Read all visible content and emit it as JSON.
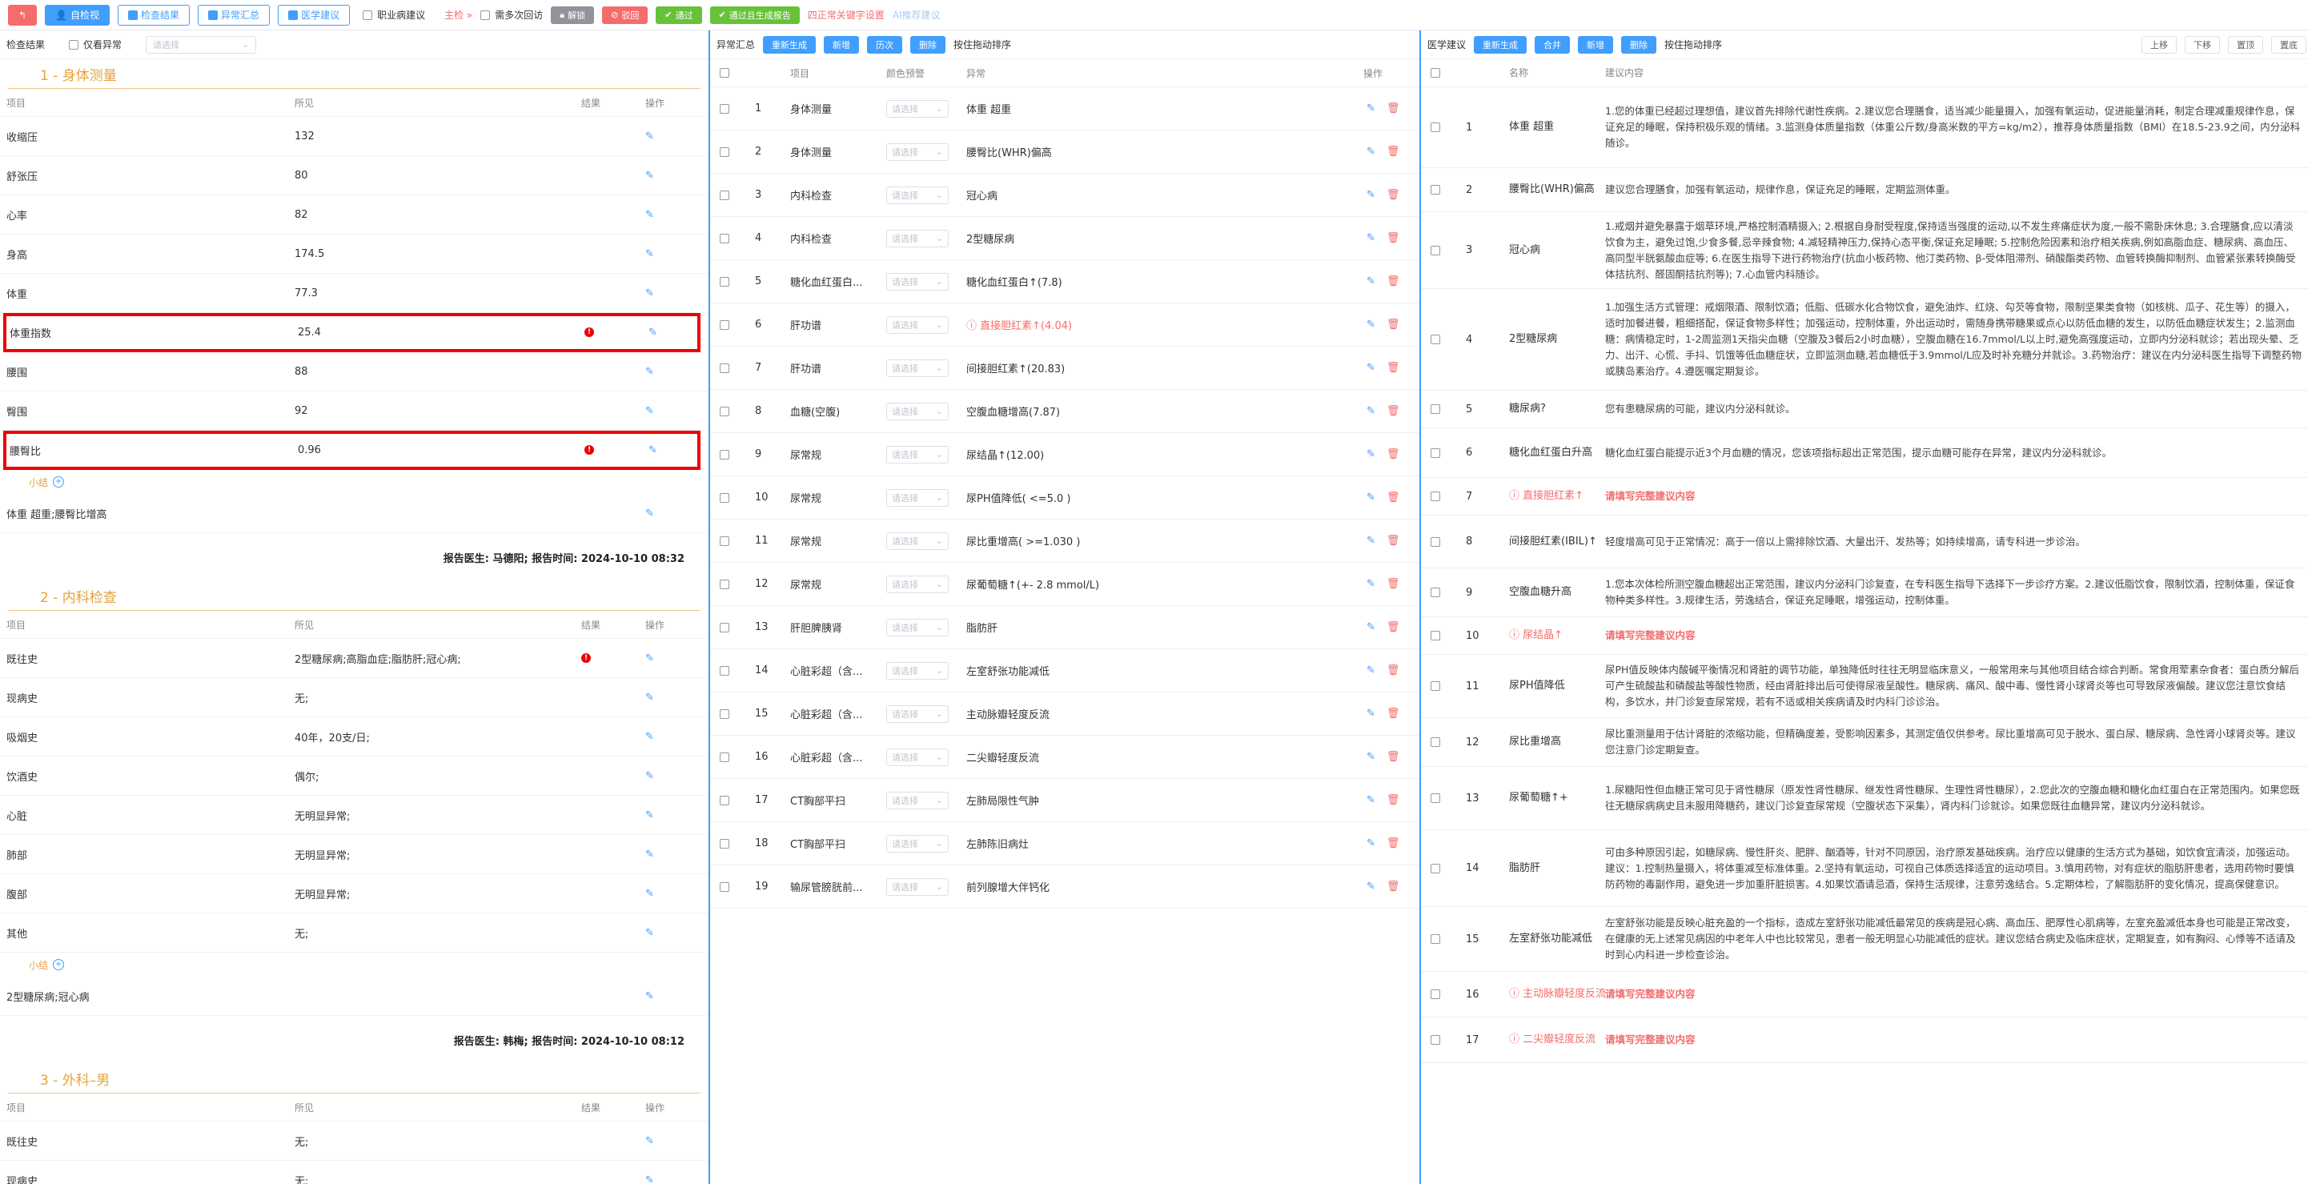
{
  "toolbar": {
    "back_label": "↰",
    "self_check_label": "自检视",
    "results_label": "检查结果",
    "abnormal_label": "异常汇总",
    "advice_label": "医学建议",
    "occupational_label": "职业病建议",
    "main_check_label": "主检 »",
    "multi_review_label": "需多次回访",
    "unlock_label": "解锁",
    "reject_label": "驳回",
    "pass_label": "通过",
    "pass_report_label": "通过且生成报告",
    "normal_shortcut_label": "四正常关键字设置",
    "ai_advice_label": "AI推荐建议"
  },
  "left": {
    "title": "检查结果",
    "only_abnormal_label": "仅看异常",
    "select_placeholder": "请选择",
    "col_item": "项目",
    "col_value": "所见",
    "col_result": "结果",
    "col_op": "操作",
    "subtotal_label": "小结",
    "sections": [
      {
        "title": "1 - 身体测量",
        "rows": [
          {
            "item": "收缩压",
            "value": "132",
            "warn": false,
            "hl": false
          },
          {
            "item": "舒张压",
            "value": "80",
            "warn": false,
            "hl": false
          },
          {
            "item": "心率",
            "value": "82",
            "warn": false,
            "hl": false
          },
          {
            "item": "身高",
            "value": "174.5",
            "warn": false,
            "hl": false
          },
          {
            "item": "体重",
            "value": "77.3",
            "warn": false,
            "hl": false
          },
          {
            "item": "体重指数",
            "value": "25.4",
            "warn": true,
            "hl": true
          },
          {
            "item": "腰围",
            "value": "88",
            "warn": false,
            "hl": false
          },
          {
            "item": "臀围",
            "value": "92",
            "warn": false,
            "hl": false
          },
          {
            "item": "腰臀比",
            "value": "0.96",
            "warn": true,
            "hl": true
          }
        ],
        "summary": "体重 超重;腰臀比增高",
        "doctor": "报告医生: 马德阳; 报告时间: 2024-10-10 08:32"
      },
      {
        "title": "2 - 内科检查",
        "rows": [
          {
            "item": "既往史",
            "value": "2型糖尿病;高脂血症;脂肪肝;冠心病;",
            "warn": true,
            "hl": false
          },
          {
            "item": "现病史",
            "value": "无;",
            "warn": false,
            "hl": false
          },
          {
            "item": "吸烟史",
            "value": "40年，20支/日;",
            "warn": false,
            "hl": false
          },
          {
            "item": "饮酒史",
            "value": "偶尔;",
            "warn": false,
            "hl": false
          },
          {
            "item": "心脏",
            "value": "无明显异常;",
            "warn": false,
            "hl": false
          },
          {
            "item": "肺部",
            "value": "无明显异常;",
            "warn": false,
            "hl": false
          },
          {
            "item": "腹部",
            "value": "无明显异常;",
            "warn": false,
            "hl": false
          },
          {
            "item": "其他",
            "value": "无;",
            "warn": false,
            "hl": false
          }
        ],
        "summary": "2型糖尿病;冠心病",
        "doctor": "报告医生: 韩梅; 报告时间: 2024-10-10 08:12"
      },
      {
        "title": "3 - 外科–男",
        "rows": [
          {
            "item": "既往史",
            "value": "无;",
            "warn": false,
            "hl": false
          },
          {
            "item": "现病史",
            "value": "无;",
            "warn": false,
            "hl": false
          }
        ],
        "summary": "",
        "doctor": ""
      }
    ]
  },
  "mid": {
    "title": "异常汇总",
    "regen_label": "重新生成",
    "add_label": "新增",
    "history_label": "历次",
    "delete_label": "删除",
    "sort_label": "按住拖动排序",
    "col_item": "项目",
    "col_color": "颜色预警",
    "col_abn": "异常",
    "col_op": "操作",
    "select_placeholder": "请选择",
    "rows": [
      {
        "no": "1",
        "item": "身体测量",
        "abn": "体重 超重",
        "red": false
      },
      {
        "no": "2",
        "item": "身体测量",
        "abn": "腰臀比(WHR)偏高",
        "red": false
      },
      {
        "no": "3",
        "item": "内科检查",
        "abn": "冠心病",
        "red": false
      },
      {
        "no": "4",
        "item": "内科检查",
        "abn": "2型糖尿病",
        "red": false
      },
      {
        "no": "5",
        "item": "糖化血红蛋白...",
        "abn": "糖化血红蛋白↑(7.8)",
        "red": false
      },
      {
        "no": "6",
        "item": "肝功谱",
        "abn": "ⓘ 直接胆红素↑(4.04)",
        "red": true
      },
      {
        "no": "7",
        "item": "肝功谱",
        "abn": "间接胆红素↑(20.83)",
        "red": false
      },
      {
        "no": "8",
        "item": "血糖(空腹)",
        "abn": "空腹血糖增高(7.87)",
        "red": false
      },
      {
        "no": "9",
        "item": "尿常规",
        "abn": "尿结晶↑(12.00)",
        "red": false
      },
      {
        "no": "10",
        "item": "尿常规",
        "abn": "尿PH值降低( <=5.0 )",
        "red": false
      },
      {
        "no": "11",
        "item": "尿常规",
        "abn": "尿比重增高( >=1.030 )",
        "red": false
      },
      {
        "no": "12",
        "item": "尿常规",
        "abn": "尿葡萄糖↑(+- 2.8 mmol/L)",
        "red": false
      },
      {
        "no": "13",
        "item": "肝胆脾胰肾",
        "abn": "脂肪肝",
        "red": false
      },
      {
        "no": "14",
        "item": "心脏彩超（含...",
        "abn": "左室舒张功能减低",
        "red": false
      },
      {
        "no": "15",
        "item": "心脏彩超（含...",
        "abn": "主动脉瓣轻度反流",
        "red": false
      },
      {
        "no": "16",
        "item": "心脏彩超（含...",
        "abn": "二尖瓣轻度反流",
        "red": false
      },
      {
        "no": "17",
        "item": "CT胸部平扫",
        "abn": "左肺局限性气肿",
        "red": false
      },
      {
        "no": "18",
        "item": "CT胸部平扫",
        "abn": "左肺陈旧病灶",
        "red": false
      },
      {
        "no": "19",
        "item": "输尿管膀胱前...",
        "abn": "前列腺增大伴钙化",
        "red": false
      }
    ]
  },
  "right": {
    "title": "医学建议",
    "regen_label": "重新生成",
    "merge_label": "合并",
    "add_label": "新增",
    "delete_label": "删除",
    "sort_label": "按住拖动排序",
    "up_label": "上移",
    "down_label": "下移",
    "top_label": "置顶",
    "bottom_label": "置底",
    "col_name": "名称",
    "col_content": "建议内容",
    "rows": [
      {
        "no": "1",
        "h": 100,
        "name": "体重 超重",
        "red": false,
        "adv": "1.您的体重已经超过理想值，建议首先排除代谢性疾病。2.建议您合理膳食，适当减少能量摄入，加强有氧运动，促进能量消耗，制定合理减重规律作息，保证充足的睡眠，保持积极乐观的情绪。3.监测身体质量指数（体重公斤数/身高米数的平方=kg/m2），推荐身体质量指数（BMI）在18.5-23.9之间，内分泌科随诊。"
      },
      {
        "no": "2",
        "h": 54,
        "name": "腰臀比(WHR)偏高",
        "red": false,
        "adv": "建议您合理膳食，加强有氧运动，规律作息，保证充足的睡眠，定期监测体重。"
      },
      {
        "no": "3",
        "h": 95,
        "name": "冠心病",
        "red": false,
        "adv": "1.戒烟并避免暴露于烟草环境,严格控制酒精摄入; 2.根据自身耐受程度,保持适当强度的运动,以不发生疼痛症状为度,一般不需卧床休息; 3.合理膳食,应以清淡饮食为主，避免过饱,少食多餐,忌辛辣食物; 4.减轻精神压力,保持心态平衡,保证充足睡眠; 5.控制危险因素和治疗相关疾病,例如高脂血症、糖尿病、高血压、高同型半胱氨酸血症等; 6.在医生指导下进行药物治疗(抗血小板药物、他汀类药物、β-受体阻滞剂、硝酸酯类药物、血管转换酶抑制剂、血管紧张素转换酶受体拮抗剂、醛固酮拮抗剂等); 7.心血管内科随诊。"
      },
      {
        "no": "4",
        "h": 126,
        "name": "2型糖尿病",
        "red": false,
        "adv": "1.加强生活方式管理：戒烟限酒、限制饮酒；低脂、低碳水化合物饮食，避免油炸、红烧、勾芡等食物，限制坚果类食物（如核桃、瓜子、花生等）的摄入，适时加餐进餐，粗细搭配，保证食物多样性；加强运动，控制体重，外出运动时，需随身携带糖果或点心以防低血糖的发生，以防低血糖症状发生；2.监测血糖：病情稳定时，1-2周监测1天指尖血糖（空腹及3餐后2小时血糖），空腹血糖在16.7mmol/L以上时,避免高强度运动，立即内分泌科就诊；若出现头晕、乏力、出汗、心慌、手抖、饥饿等低血糖症状，立即监测血糖,若血糖低于3.9mmol/L应及时补充糖分并就诊。3.药物治疗：建议在内分泌科医生指导下调整药物或胰岛素治疗。4.遵医嘱定期复诊。"
      },
      {
        "no": "5",
        "h": 46,
        "name": "糖尿病?",
        "red": false,
        "adv": "您有患糖尿病的可能，建议内分泌科就诊。"
      },
      {
        "no": "6",
        "h": 61,
        "name": "糖化血红蛋白升高",
        "red": false,
        "adv": "糖化血红蛋白能提示近3个月血糖的情况，您该项指标超出正常范围，提示血糖可能存在异常，建议内分泌科就诊。"
      },
      {
        "no": "7",
        "h": 46,
        "name": "ⓘ 直接胆红素↑",
        "red": true,
        "adv": "请填写完整建议内容"
      },
      {
        "no": "8",
        "h": 65,
        "name": "间接胆红素(IBIL)↑",
        "red": false,
        "adv": "轻度增高可见于正常情况：高于一倍以上需排除饮酒、大量出汗、发热等；如持续增高，请专科进一步诊治。"
      },
      {
        "no": "9",
        "h": 60,
        "name": "空腹血糖升高",
        "red": false,
        "adv": "1.您本次体检所测空腹血糖超出正常范围，建议内分泌科门诊复查，在专科医生指导下选择下一步诊疗方案。2.建议低脂饮食，限制饮酒，控制体重，保证食物种类多样性。3.规律生活，劳逸结合，保证充足睡眠，增强运动，控制体重。"
      },
      {
        "no": "10",
        "h": 46,
        "name": "ⓘ 尿结晶↑",
        "red": true,
        "adv": "请填写完整建议内容"
      },
      {
        "no": "11",
        "h": 78,
        "name": "尿PH值降低",
        "red": false,
        "adv": "尿PH值反映体内酸碱平衡情况和肾脏的调节功能，单独降低时往往无明显临床意义，一般常用来与其他项目结合综合判断。常食用荤素杂食者：蛋白质分解后可产生硫酸盐和磷酸盐等酸性物质，经由肾脏排出后可使得尿液呈酸性。糖尿病、痛风、酸中毒、慢性肾小球肾炎等也可导致尿液偏酸。建议您注意饮食结构，多饮水，并门诊复查尿常规，若有不适或相关疾病请及时内科门诊诊治。"
      },
      {
        "no": "12",
        "h": 60,
        "name": "尿比重增高",
        "red": false,
        "adv": "尿比重测量用于估计肾脏的浓缩功能，但精确度差，受影响因素多，其测定值仅供参考。尿比重增高可见于脱水、蛋白尿、糖尿病、急性肾小球肾炎等。建议您注意门诊定期复查。"
      },
      {
        "no": "13",
        "h": 78,
        "name": "尿葡萄糖↑+",
        "red": false,
        "adv": "1.尿糖阳性但血糖正常可见于肾性糖尿（原发性肾性糖尿、继发性肾性糖尿、生理性肾性糖尿），2.您此次的空腹血糖和糖化血红蛋白在正常范围内。如果您既往无糖尿病病史且未服用降糖药，建议门诊复查尿常规（空腹状态下采集），肾内科门诊就诊。如果您既往血糖异常，建议内分泌科就诊。"
      },
      {
        "no": "14",
        "h": 95,
        "name": "脂肪肝",
        "red": false,
        "adv": "可由多种原因引起，如糖尿病、慢性肝炎、肥胖、酗酒等，针对不同原因，治疗原发基础疾病。治疗应以健康的生活方式为基础，如饮食宜清淡，加强运动。建议：1.控制热量摄入，将体重减至标准体重。2.坚持有氧运动，可视自己体质选择适宜的运动项目。3.慎用药物，对有症状的脂肪肝患者，选用药物时要慎防药物的毒副作用，避免进一步加重肝脏损害。4.如果饮酒请忌酒，保持生活规律，注意劳逸结合。5.定期体检，了解脂肪肝的变化情况，提高保健意识。"
      },
      {
        "no": "15",
        "h": 80,
        "name": "左室舒张功能减低",
        "red": false,
        "adv": "左室舒张功能是反映心脏充盈的一个指标，造成左室舒张功能减低最常见的疾病是冠心病、高血压、肥厚性心肌病等，左室充盈减低本身也可能是正常改变，在健康的无上述常见病因的中老年人中也比较常见，患者一般无明显心功能减低的症状。建议您结合病史及临床症状，定期复查，如有胸闷、心悸等不适请及时到心内科进一步检查诊治。"
      },
      {
        "no": "16",
        "h": 56,
        "name": "ⓘ 主动脉瓣轻度反流",
        "red": true,
        "adv": "请填写完整建议内容"
      },
      {
        "no": "17",
        "h": 56,
        "name": "ⓘ 二尖瓣轻度反流",
        "red": true,
        "adv": "请填写完整建议内容"
      }
    ]
  }
}
